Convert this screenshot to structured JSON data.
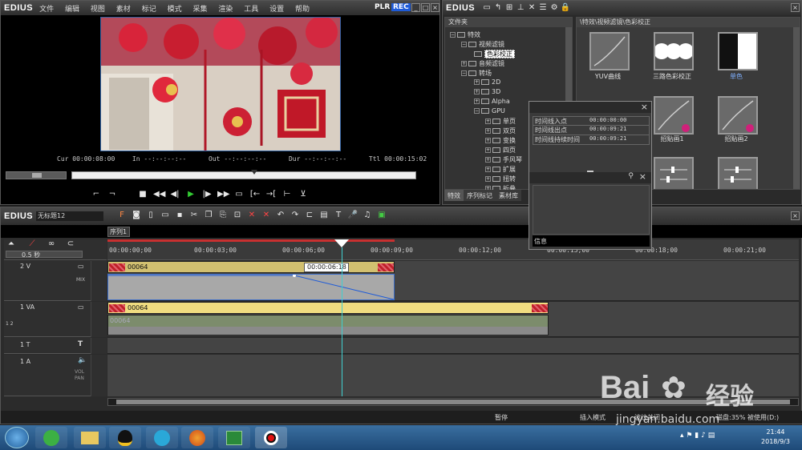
{
  "player": {
    "brand": "EDIUS",
    "menu": [
      "文件",
      "编辑",
      "视图",
      "素材",
      "标记",
      "模式",
      "采集",
      "渲染",
      "工具",
      "设置",
      "帮助"
    ],
    "plr": "PLR",
    "rec": "REC",
    "cur_label": "Cur",
    "cur_value": "00:00:08:00",
    "in_label": "In",
    "in_value": "--:--:--:--",
    "out_label": "Out",
    "out_value": "--:--:--:--",
    "dur_label": "Dur",
    "dur_value": "--:--:--:--",
    "ttl_label": "Ttl",
    "ttl_value": "00:00:15:02"
  },
  "effects_panel": {
    "brand": "EDIUS",
    "tree_header": "文件夹",
    "path": "\\特效\\视频滤镜\\色彩校正",
    "tree": [
      "特效",
      "视频滤镜",
      "色彩校正",
      "音频滤镜",
      "转场",
      "2D",
      "3D",
      "Alpha",
      "GPU",
      "单页",
      "双页",
      "变换",
      "四页",
      "手风琴",
      "扩展",
      "扭转",
      "折叠"
    ],
    "effects": [
      "YUV曲线",
      "三路色彩校正",
      "单色",
      "",
      "招贴画1",
      "招贴画2"
    ],
    "tabs": [
      "特效",
      "序列标记",
      "素材库"
    ]
  },
  "info_panel": {
    "rows": [
      {
        "label": "时间线入点",
        "value": "00:00:00:00"
      },
      {
        "label": "时间线出点",
        "value": "00:00:09:21"
      },
      {
        "label": "时间线持续时间",
        "value": "00:00:09:21"
      }
    ],
    "tab": "信息"
  },
  "timeline": {
    "brand": "EDIUS",
    "project": "无标题12",
    "sequence_tab": "序列1",
    "scale": "0.5 秒",
    "ruler": [
      "00:00:00;00",
      "00:00:03;00",
      "00:00:06;00",
      "00:00:09;00",
      "00:00:12;00",
      "00:00:15;00",
      "00:00:18;00",
      "00:00:21;00"
    ],
    "cursor_tooltip": "00:00:06:18",
    "tracks": [
      {
        "name": "2 V",
        "mix": "MIX"
      },
      {
        "name": "1 VA",
        "sub": "1 2"
      },
      {
        "name": "1 T"
      },
      {
        "name": "1 A",
        "vol": "VOL PAN"
      }
    ],
    "clip_name": "00064",
    "status": [
      "暂停",
      "插入模式",
      "波纹关闭",
      "磁盘:35% 被使用(D:)"
    ]
  },
  "taskbar": {
    "time": "21:44",
    "date": "2018/9/3"
  },
  "watermark": {
    "text": "Bai",
    "text2": "经验",
    "url": "jingyan.baidu.com"
  }
}
